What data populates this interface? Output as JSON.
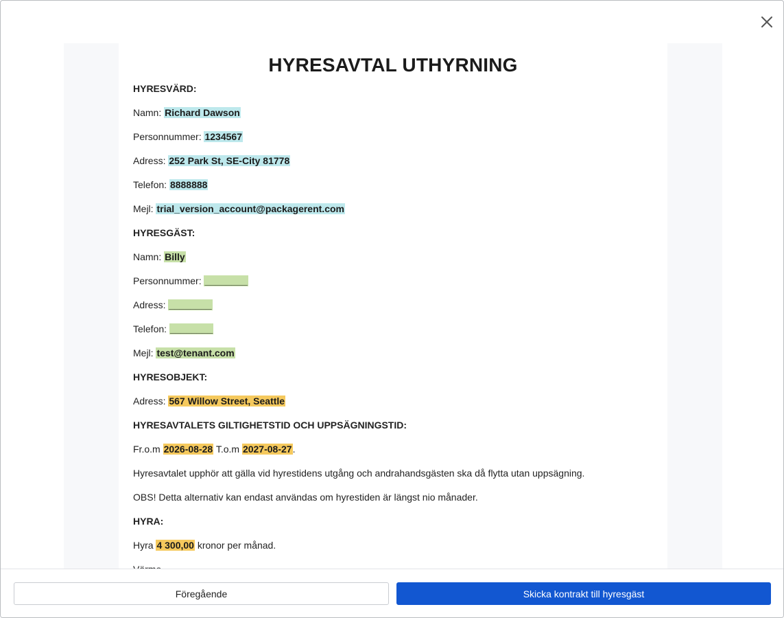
{
  "document": {
    "title": "HYRESAVTAL UTHYRNING",
    "landlord": {
      "heading": "HYRESVÄRD:",
      "name_label": "Namn:",
      "name_value": "Richard Dawson",
      "personal_id_label": "Personnummer:",
      "personal_id_value": "1234567",
      "address_label": "Adress:",
      "address_value": "252 Park St, SE-City 81778",
      "phone_label": "Telefon:",
      "phone_value": "8888888",
      "email_label": "Mejl:",
      "email_value": "trial_version_account@packagerent.com"
    },
    "tenant": {
      "heading": "HYRESGÄST:",
      "name_label": "Namn:",
      "name_value": "Billy",
      "personal_id_label": "Personnummer:",
      "personal_id_value": "________",
      "address_label": "Adress:",
      "address_value": "________",
      "phone_label": "Telefon:",
      "phone_value": "________",
      "email_label": "Mejl:",
      "email_value": "test@tenant.com"
    },
    "property": {
      "heading": "HYRESOBJEKT:",
      "address_label": "Adress:",
      "address_value": "567 Willow Street, Seattle"
    },
    "term": {
      "heading": "HYRESAVTALETS GILTIGHETSTID OCH UPPSÄGNINGSTID:",
      "from_label": "Fr.o.m",
      "from_value": "2026-08-28",
      "to_label": "T.o.m",
      "to_value": "2027-08-27",
      "end_punct": ".",
      "note_1": "Hyresavtalet upphör att gälla vid hyrestidens utgång och andrahandsgästen ska då flytta utan uppsägning.",
      "note_2": "OBS! Detta alternativ kan endast användas om hyrestiden är längst nio månader."
    },
    "rent": {
      "heading": "HYRA:",
      "rent_label": "Hyra",
      "rent_value": "4 300,00",
      "rent_suffix": "kronor per månad.",
      "next_line_partial": "Värme"
    }
  },
  "footer": {
    "prev_label": "Föregående",
    "send_label": "Skicka kontrakt till hyresgäst"
  },
  "colors": {
    "landlord_highlight": "#bde8ec",
    "tenant_highlight": "#c7e0a8",
    "contract_highlight": "#f5c95d",
    "primary_button": "#1257d1"
  },
  "icons": {
    "close": "close-icon"
  }
}
